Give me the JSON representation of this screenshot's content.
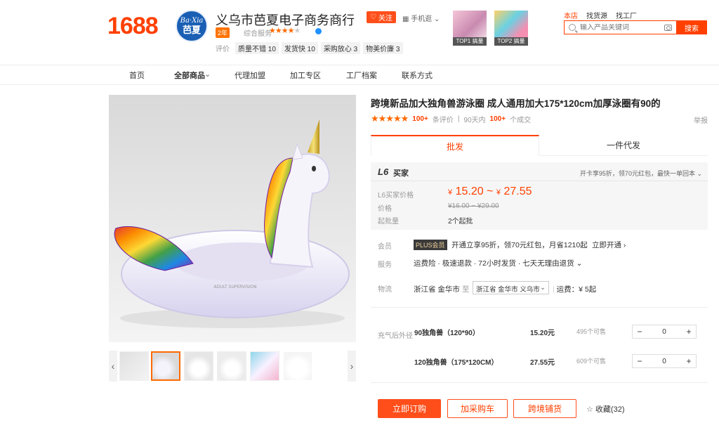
{
  "header": {
    "logo": "1688",
    "shop_logo_line1": "Ba·Xia",
    "shop_logo_line2": "芭夏",
    "shop_name": "义乌市芭夏电子商务商行",
    "years_badge": "2年",
    "service_label": "综合服务",
    "service_stars": "★★★★",
    "service_stars_empty": "★",
    "follow_label": "关注",
    "mobile_label": "手机逛",
    "eval_label": "评价",
    "eval_tags": [
      "质量不错 10",
      "发货快 10",
      "采购放心 3",
      "物美价廉 3"
    ],
    "top_items": [
      {
        "caption": "TOP1 搞量"
      },
      {
        "caption": "TOP2 搞量"
      }
    ],
    "search_tabs": [
      "本店",
      "找货源",
      "找工厂"
    ],
    "search_placeholder": "输入产品关键词",
    "search_button": "搜索"
  },
  "nav": {
    "items": [
      "首页",
      "全部商品",
      "代理加盟",
      "加工专区",
      "工厂档案",
      "联系方式"
    ]
  },
  "product": {
    "title": "跨境新品加大独角兽游泳圈 成人通用加大175*120cm加厚泳圈有90的",
    "rating_stars": "★★★★★",
    "review_count": "100+",
    "review_label": "条评价",
    "deal_prefix": "90天内",
    "deal_count": "100+",
    "deal_label": "个成交",
    "report": "举报"
  },
  "tabs": [
    "批发",
    "一件代发"
  ],
  "price": {
    "level_badge": "L6",
    "level_title": "买家",
    "perk": "开卡享95折，领70元红包，最快一单回本",
    "l6_label": "L6买家价格",
    "yen": "¥",
    "low": "15.20",
    "tilde": "~",
    "high": "27.55",
    "price_label": "价格",
    "original": "¥16.00 ~ ¥29.00",
    "moq_label": "起批量",
    "moq": "2个起批"
  },
  "member": {
    "label": "会员",
    "badge": "PLUS会员",
    "text": "开通立享95折，领70元红包，月省1210起",
    "link": "立即开通"
  },
  "service": {
    "label": "服务",
    "text": "运费险 · 极速退款 · 72小时发货 · 七天无理由退货"
  },
  "shipping": {
    "label": "物流",
    "from": "浙江省 金华市",
    "to_label": "至",
    "to": "浙江省 金华市 义乌市",
    "fee": "运费：¥ 5起"
  },
  "variants": {
    "label": "充气后外径",
    "items": [
      {
        "name": "90独角兽（120*90）",
        "price": "15.20元",
        "stock": "495个可售",
        "qty": "0"
      },
      {
        "name": "120独角兽（175*120CM）",
        "price": "27.55元",
        "stock": "609个可售",
        "qty": "0"
      }
    ]
  },
  "actions": {
    "buy": "立即订购",
    "cart": "加采购车",
    "cross": "跨境铺货",
    "favorite": "收藏(32)"
  },
  "colors": {
    "brand": "#ff4000",
    "accent": "#ff4e1a",
    "star": "#ff6a00"
  }
}
